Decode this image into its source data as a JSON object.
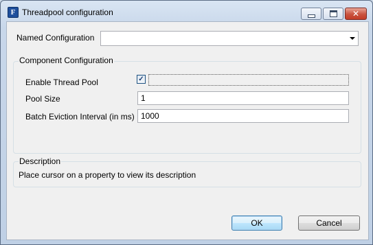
{
  "window": {
    "title": "Threadpool configuration",
    "icon": "F"
  },
  "named_configuration": {
    "label": "Named Configuration",
    "value": ""
  },
  "component_configuration": {
    "title": "Component Configuration",
    "enable_thread_pool": {
      "label": "Enable Thread Pool",
      "checked": true,
      "check_glyph": "✓"
    },
    "pool_size": {
      "label": "Pool Size",
      "value": "1"
    },
    "batch_eviction_interval": {
      "label": "Batch Eviction Interval (in ms)",
      "value": "1000"
    }
  },
  "description": {
    "title": "Description",
    "text": "Place cursor on a property to view its description"
  },
  "buttons": {
    "ok": "OK",
    "cancel": "Cancel"
  }
}
